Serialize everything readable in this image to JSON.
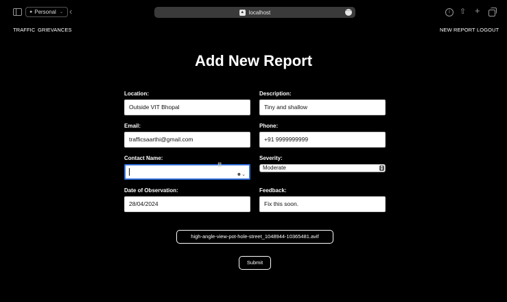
{
  "browser": {
    "profile_label": "Personal",
    "url": "localhost"
  },
  "nav": {
    "traffic": "TRAFFIC",
    "grievances": "GRIEVANCES",
    "new_report": "NEW REPORT",
    "logout": "LOGOUT"
  },
  "page": {
    "title": "Add New Report"
  },
  "form": {
    "location": {
      "label": "Location:",
      "value": "Outside VIT Bhopal"
    },
    "description": {
      "label": "Description:",
      "value": "Tiny and shallow"
    },
    "email": {
      "label": "Email:",
      "value": "trafficsaarthi@gmail.com"
    },
    "phone": {
      "label": "Phone:",
      "value": "+91 9999999999"
    },
    "contact_name": {
      "label": "Contact Name:",
      "value": ""
    },
    "severity": {
      "label": "Severity:",
      "selected": "Moderate"
    },
    "date": {
      "label": "Date of Observation:",
      "value": "28/04/2024"
    },
    "feedback": {
      "label": "Feedback:",
      "value": "Fix this soon."
    },
    "file_name": "high-angle-view-pot-hole-street_1048944-10365481.avif",
    "submit_label": "Submit"
  },
  "icons": {
    "sidebar": "sidebar-toggle-icon",
    "profile": "person-icon",
    "back": "chevron-left-icon",
    "site": "site-icon",
    "more": "ellipsis-icon",
    "info": "info-icon",
    "share": "share-icon",
    "new_tab": "plus-icon",
    "tabs": "tabs-overview-icon",
    "contact_autofill": "contact-autofill-icon",
    "text_cursor": "text-cursor-icon"
  },
  "colors": {
    "background": "#000000",
    "focus_ring": "#2f6bd6",
    "urlbar": "#3a3a3a"
  }
}
